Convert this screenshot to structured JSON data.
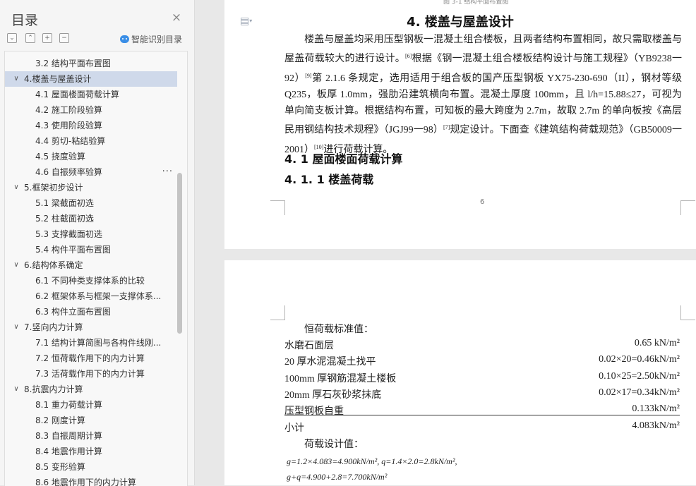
{
  "nav": {
    "title": "目录",
    "close_icon": "close-icon",
    "tools": [
      "collapse-all-icon",
      "expand-all-icon",
      "add-heading-icon",
      "remove-heading-icon"
    ],
    "ai_label": "智能识别目录",
    "items": [
      {
        "label": "3.2 结构平面布置图",
        "level": 2
      },
      {
        "label": "4.楼盖与屋盖设计",
        "level": 1,
        "expanded": true,
        "active": true
      },
      {
        "label": "4.1 屋面楼面荷载计算",
        "level": 2
      },
      {
        "label": "4.2 施工阶段验算",
        "level": 2
      },
      {
        "label": "4.3 使用阶段验算",
        "level": 2
      },
      {
        "label": "4.4 剪切-粘结验算",
        "level": 2
      },
      {
        "label": "4.5 挠度验算",
        "level": 2
      },
      {
        "label": "4.6 自振频率验算",
        "level": 2,
        "more": "..."
      },
      {
        "label": "5.框架初步设计",
        "level": 1,
        "expanded": true
      },
      {
        "label": "5.1 梁截面初选",
        "level": 2
      },
      {
        "label": "5.2 柱截面初选",
        "level": 2
      },
      {
        "label": "5.3 支撑截面初选",
        "level": 2
      },
      {
        "label": "5.4 构件平面布置图",
        "level": 2
      },
      {
        "label": "6.结构体系确定",
        "level": 1,
        "expanded": true
      },
      {
        "label": "6.1 不同种类支撑体系的比较",
        "level": 2
      },
      {
        "label": "6.2 框架体系与框架一支撑体系...",
        "level": 2
      },
      {
        "label": "6.3 构件立面布置图",
        "level": 2
      },
      {
        "label": "7.竖向内力计算",
        "level": 1,
        "expanded": true
      },
      {
        "label": "7.1 结构计算简图与各构件线刚...",
        "level": 2
      },
      {
        "label": "7.2 恒荷载作用下的内力计算",
        "level": 2
      },
      {
        "label": "7.3 活荷载作用下的内力计算",
        "level": 2
      },
      {
        "label": "8.抗震内力计算",
        "level": 1,
        "expanded": true
      },
      {
        "label": "8.1 重力荷载计算",
        "level": 2
      },
      {
        "label": "8.2 刚度计算",
        "level": 2
      },
      {
        "label": "8.3 自振周期计算",
        "level": 2
      },
      {
        "label": "8.4 地震作用计算",
        "level": 2
      },
      {
        "label": "8.5 变形验算",
        "level": 2
      },
      {
        "label": "8.6 地震作用下的内力计算",
        "level": 2
      }
    ]
  },
  "page1": {
    "caption_top": "图 3-1 结构平面布置图",
    "heading": "4. 楼盖与屋盖设计",
    "paragraph": {
      "t1": "楼盖与屋盖均采用压型钢板一混凝土组合楼板，且两者结构布置相同，故只需取楼盖与屋盖荷载较大的进行设计。",
      "r1": "[6]",
      "t2": "根据《钢一混凝土组合楼板结构设计与施工规程》（YB9238一92）",
      "r2": "[9]",
      "t3": "第 2.1.6 条规定，选用适用于组合板的国产压型钢板 YX75-230-690（II），钢材等级 Q235，板厚 1.0mm，强肋沿建筑横向布置。混凝土厚度 100mm，且 l/h=15.88≤27，可视为单向简支板计算。根据结构布置，可知板的最大跨度为 2.7m，故取 2.7m 的单向板按《高层民用钢结构技术规程》（JGJ99一98）",
      "r3": "[7]",
      "t4": "规定设计。下面查《建筑结构荷载规范》（GB50009一2001）",
      "r4": "[10]",
      "t5": "进行荷载计算。"
    },
    "h2_1": "4. 1  屋面楼面荷载计算",
    "h2_2": "4. 1. 1  楼盖荷载",
    "page_number": "6"
  },
  "page2": {
    "dead_load_label": "恒荷载标准值：",
    "rows": [
      {
        "name": "水磨石面层",
        "value": "0.65 kN/m²"
      },
      {
        "name": "20 厚水泥混凝土找平",
        "value": "0.02×20=0.46kN/m²"
      },
      {
        "name": "100mm 厚钢筋混凝土楼板",
        "value": "0.10×25=2.50kN/m²"
      },
      {
        "name": "20mm 厚石灰砂浆抹底",
        "value": "0.02×17=0.34kN/m²"
      },
      {
        "name": "压型钢板自重",
        "value": "0.133kN/m²"
      },
      {
        "name": "小计",
        "value": "4.083kN/m²"
      }
    ],
    "design_load_label": "荷载设计值：",
    "formula1": "g=1.2×4.083=4.900kN/m², q=1.4×2.0=2.8kN/m²,",
    "formula2": "g+q=4.900+2.8=7.700kN/m²"
  }
}
